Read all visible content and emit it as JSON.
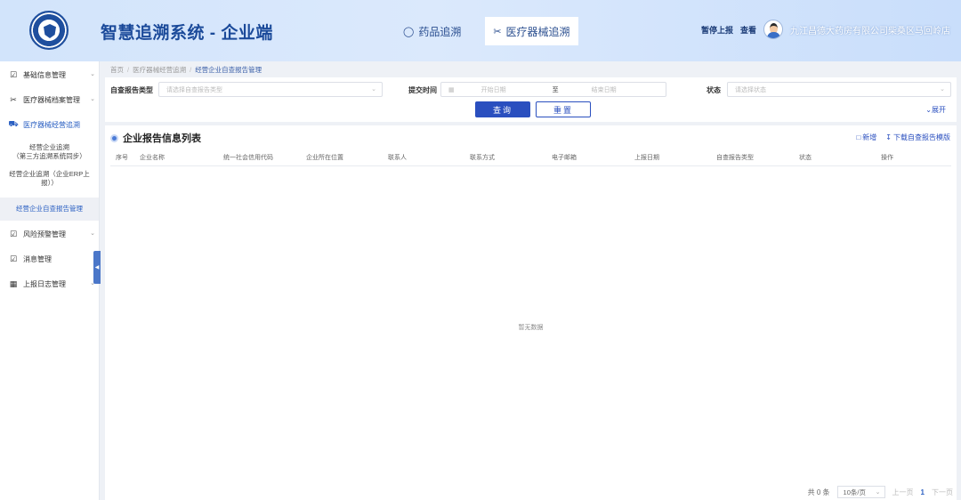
{
  "header": {
    "app_title": "智慧追溯系统 - 企业端",
    "nav": [
      {
        "label": "药品追溯",
        "icon": "pill-icon",
        "active": false
      },
      {
        "label": "医疗器械追溯",
        "icon": "scissors-icon",
        "active": true
      }
    ],
    "links": [
      "暂停上报",
      "查看"
    ],
    "company": "九江昌德大药房有限公司柴桑区马回岭店"
  },
  "sidebar": {
    "items": [
      {
        "label": "基础信息管理",
        "icon": "checkbox-icon"
      },
      {
        "label": "医疗器械档案管理",
        "icon": "scissors-icon"
      },
      {
        "label": "医疗器械经营追溯",
        "icon": "truck-icon"
      }
    ],
    "subitems": [
      {
        "label": "经营企业追溯\n（第三方追溯系统同步）",
        "active": false
      },
      {
        "label": "经营企业追溯（企业ERP上报））",
        "active": false
      },
      {
        "label": "经营企业自查报告管理",
        "active": true
      }
    ],
    "items2": [
      {
        "label": "风险预警管理",
        "icon": "checkbox-icon"
      },
      {
        "label": "消息管理",
        "icon": "checkbox-icon"
      },
      {
        "label": "上报日志管理",
        "icon": "calendar-icon"
      }
    ]
  },
  "breadcrumb": [
    "首页",
    "医疗器械经营追溯",
    "经营企业自查报告管理"
  ],
  "filter": {
    "report_type_label": "自查报告类型",
    "report_type_placeholder": "请选择自查报告类型",
    "submit_time_label": "提交时间",
    "start_placeholder": "开始日期",
    "range_sep": "至",
    "end_placeholder": "结束日期",
    "status_label": "状态",
    "status_placeholder": "请选择状态",
    "query_label": "查询",
    "reset_label": "重置",
    "expand_label": "展开"
  },
  "list": {
    "title": "企业报告信息列表",
    "add_label": "新增",
    "download_label": "下载自查报告模版",
    "columns": [
      "序号",
      "企业名称",
      "统一社会信用代码",
      "企业所在位置",
      "联系人",
      "联系方式",
      "电子邮箱",
      "上报日期",
      "自查报告类型",
      "状态",
      "操作"
    ],
    "empty_text": "暂无数据"
  },
  "pager": {
    "total": "共 0 条",
    "page_size": "10条/页",
    "prev": "上一页",
    "current": "1",
    "next": "下一页"
  },
  "colors": {
    "primary": "#2a4fbf",
    "header_bg": "#d2e4fb",
    "title": "#1b4a9a"
  }
}
